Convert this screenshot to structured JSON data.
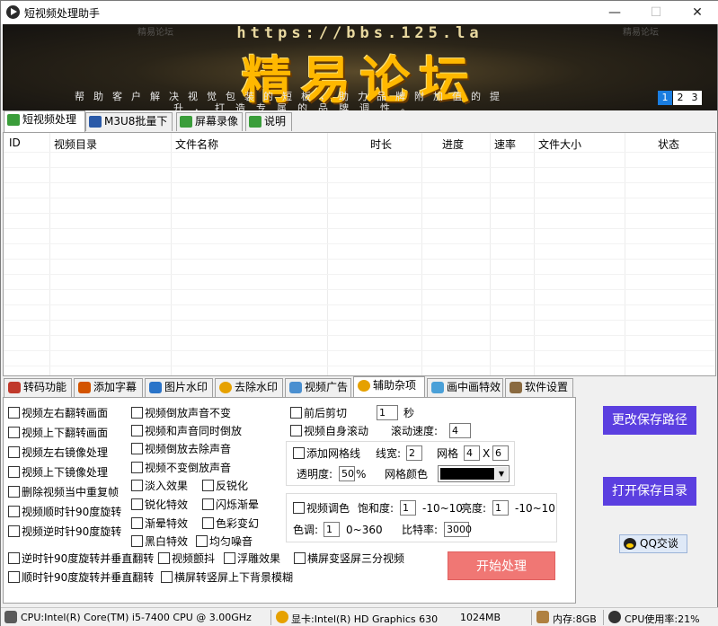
{
  "window": {
    "title": "短视频处理助手"
  },
  "banner": {
    "url": "https://bbs.125.la",
    "headline": "精易论坛",
    "slogan_line1": "帮助客户解决视觉包装的短板，助力品牌附加值的提",
    "slogan_line2": "升，打造专属的品牌调性。",
    "watermark": "精易论坛",
    "pages": [
      "1",
      "2",
      "3"
    ],
    "active_page": "1"
  },
  "top_tabs": [
    {
      "label": "短视频处理",
      "icon": "video-process-icon",
      "color": "#3a9d3a"
    },
    {
      "label": "M3U8批量下载",
      "icon": "grid-download-icon",
      "color": "#2a5aa8"
    },
    {
      "label": "屏幕录像",
      "icon": "screen-record-icon",
      "color": "#3a9d3a"
    },
    {
      "label": "说明",
      "icon": "info-icon",
      "color": "#3a9d3a"
    }
  ],
  "grid": {
    "columns": [
      "ID",
      "视频目录",
      "文件名称",
      "时长",
      "进度",
      "速率",
      "文件大小",
      "状态"
    ]
  },
  "bottom_tabs": [
    {
      "label": "转码功能",
      "icon": "penguin-icon",
      "color": "#c0392b"
    },
    {
      "label": "添加字幕",
      "icon": "pen-icon",
      "color": "#d35400"
    },
    {
      "label": "图片水印",
      "icon": "folder-icon",
      "color": "#2a74c9"
    },
    {
      "label": "去除水印",
      "icon": "sun-icon",
      "color": "#e6a100"
    },
    {
      "label": "视频广告",
      "icon": "landscape-icon",
      "color": "#4a8fd0"
    },
    {
      "label": "辅助杂项",
      "icon": "gear-icon",
      "color": "#e6a100"
    },
    {
      "label": "画中画特效",
      "icon": "cloud-icon",
      "color": "#4aa0d8"
    },
    {
      "label": "软件设置",
      "icon": "wrench-icon",
      "color": "#8a6a40"
    }
  ],
  "options": {
    "col1": [
      "视频左右翻转画面",
      "视频上下翻转画面",
      "视频左右镜像处理",
      "视频上下镜像处理",
      "删除视频当中重复帧",
      "视频顺时针90度旋转",
      "视频逆时针90度旋转"
    ],
    "col2": [
      "视频倒放声音不变",
      "视频和声音同时倒放",
      "视频倒放去除声音",
      "视频不变倒放声音"
    ],
    "fx": [
      "淡入效果",
      "反锐化",
      "锐化特效",
      "闪烁渐晕",
      "渐晕特效",
      "色彩变幻",
      "黑白特效",
      "均匀噪音"
    ],
    "rotate_flip_ccw": "逆时针90度旋转并垂直翻转",
    "rotate_flip_cw": "顺时针90度旋转并垂直翻转",
    "jitter": "视频颤抖",
    "emboss": "浮雕效果",
    "landscape_to_portrait_3": "横屏变竖屏三分视频",
    "landscape_to_portrait_blur": "横屏转竖屏上下背景模糊"
  },
  "trim": {
    "label": "前后剪切",
    "value": "1",
    "unit": "秒"
  },
  "scroll": {
    "label": "视频自身滚动",
    "speed_label": "滚动速度:",
    "speed_value": "4"
  },
  "gridline": {
    "label": "添加网格线",
    "width_label": "线宽:",
    "width_value": "2",
    "grid_label": "网格",
    "grid_x": "4",
    "x_sep": "X",
    "grid_y": "6",
    "opacity_label": "透明度:",
    "opacity_value": "50",
    "opacity_unit": "%",
    "color_label": "网格颜色",
    "color_value": "#000000"
  },
  "color_adjust": {
    "label": "视频调色",
    "saturation_label": "饱和度:",
    "saturation_value": "1",
    "saturation_range": "-10~10",
    "brightness_label": "亮度:",
    "brightness_value": "1",
    "brightness_range": "-10~10",
    "hue_label": "色调:",
    "hue_value": "1",
    "hue_range": "0~360",
    "bitrate_label": "比特率:",
    "bitrate_value": "3000"
  },
  "buttons": {
    "start": "开始处理",
    "change_path": "更改保存路径",
    "open_dir": "打开保存目录",
    "qq": "QQ交谈"
  },
  "status": {
    "cpu": "CPU:Intel(R) Core(TM) i5-7400 CPU @ 3.00GHz",
    "gpu": "显卡:Intel(R) HD Graphics 630",
    "vram": "1024MB",
    "mem": "内存:8GB",
    "cpu_usage": "CPU使用率:21%"
  }
}
